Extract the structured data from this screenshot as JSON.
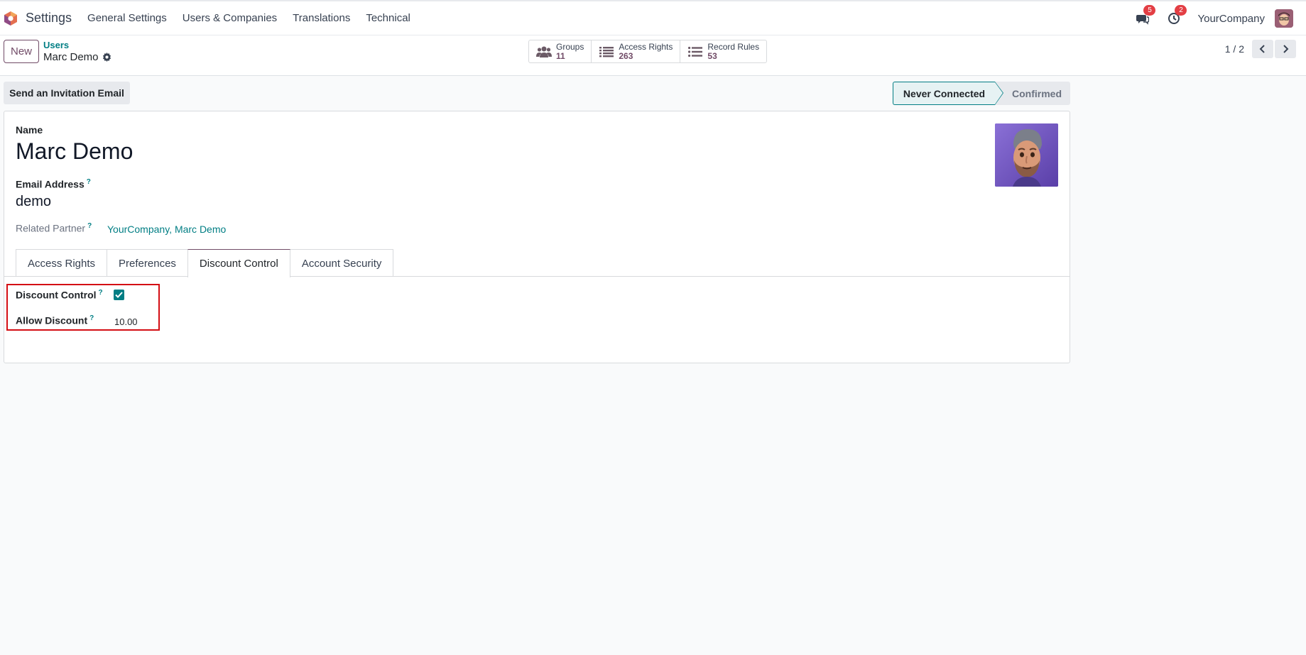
{
  "navbar": {
    "app_name": "Settings",
    "menu": [
      "General Settings",
      "Users & Companies",
      "Translations",
      "Technical"
    ],
    "messages_count": "5",
    "activities_count": "2",
    "company": "YourCompany"
  },
  "control_panel": {
    "new_label": "New",
    "breadcrumb_parent": "Users",
    "breadcrumb_current": "Marc Demo",
    "smart_buttons": [
      {
        "label": "Groups",
        "value": "11",
        "icon": "users-icon"
      },
      {
        "label": "Access Rights",
        "value": "263",
        "icon": "list-icon"
      },
      {
        "label": "Record Rules",
        "value": "53",
        "icon": "list-icon"
      }
    ],
    "pager": "1 / 2"
  },
  "statusbar": {
    "invite_label": "Send an Invitation Email",
    "stages": [
      "Never Connected",
      "Confirmed"
    ],
    "active_stage": "Never Connected"
  },
  "form": {
    "name_label": "Name",
    "name_value": "Marc Demo",
    "email_label": "Email Address",
    "email_value": "demo",
    "partner_label": "Related Partner",
    "partner_value": "YourCompany, Marc Demo",
    "help_mark": "?",
    "tabs": [
      "Access Rights",
      "Preferences",
      "Discount Control",
      "Account Security"
    ],
    "active_tab": "Discount Control",
    "discount_control_label": "Discount Control",
    "discount_control_checked": true,
    "allow_discount_label": "Allow Discount",
    "allow_discount_value": "10.00"
  },
  "colors": {
    "brand": "#714b67",
    "accent": "#017e84",
    "highlight": "#d40e14",
    "badge": "#e33e44"
  }
}
